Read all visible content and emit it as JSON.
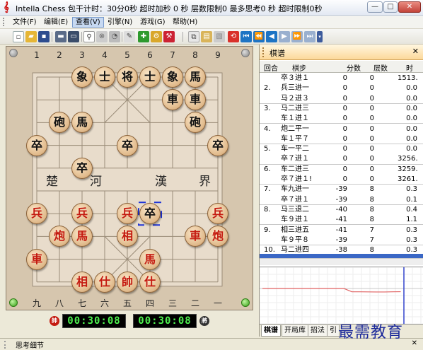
{
  "window": {
    "title": "Intella Chess 包干计时：30分0秒 超时加秒 0 秒 层数限制0 最多思考0 秒 超时限制0秒",
    "minimize": "—",
    "maximize": "□",
    "close": "✕"
  },
  "menu": [
    {
      "label": "文件(F)"
    },
    {
      "label": "编辑(E)"
    },
    {
      "label": "查看(V)"
    },
    {
      "label": "引擎(N)"
    },
    {
      "label": "游戏(G)"
    },
    {
      "label": "帮助(H)"
    }
  ],
  "board": {
    "files_top": [
      "1",
      "2",
      "3",
      "4",
      "5",
      "6",
      "7",
      "8",
      "9"
    ],
    "files_bottom": [
      "九",
      "八",
      "七",
      "六",
      "五",
      "四",
      "三",
      "二",
      "一"
    ],
    "river_left": [
      "楚",
      "河"
    ],
    "river_right": [
      "漢",
      "界"
    ],
    "pieces": [
      {
        "c": "black",
        "ch": "象",
        "f": 3,
        "r": 1
      },
      {
        "c": "black",
        "ch": "士",
        "f": 4,
        "r": 1
      },
      {
        "c": "black",
        "ch": "将",
        "f": 5,
        "r": 1
      },
      {
        "c": "black",
        "ch": "士",
        "f": 6,
        "r": 1
      },
      {
        "c": "black",
        "ch": "象",
        "f": 7,
        "r": 1
      },
      {
        "c": "black",
        "ch": "馬",
        "f": 8,
        "r": 1
      },
      {
        "c": "black",
        "ch": "車",
        "f": 7,
        "r": 2
      },
      {
        "c": "black",
        "ch": "車",
        "f": 8,
        "r": 2
      },
      {
        "c": "black",
        "ch": "砲",
        "f": 2,
        "r": 3
      },
      {
        "c": "black",
        "ch": "馬",
        "f": 3,
        "r": 3
      },
      {
        "c": "black",
        "ch": "砲",
        "f": 8,
        "r": 3
      },
      {
        "c": "black",
        "ch": "卒",
        "f": 1,
        "r": 4
      },
      {
        "c": "black",
        "ch": "卒",
        "f": 5,
        "r": 4
      },
      {
        "c": "black",
        "ch": "卒",
        "f": 9,
        "r": 4
      },
      {
        "c": "black",
        "ch": "卒",
        "f": 3,
        "r": 5
      },
      {
        "c": "red",
        "ch": "兵",
        "f": 1,
        "r": 7
      },
      {
        "c": "red",
        "ch": "兵",
        "f": 3,
        "r": 7
      },
      {
        "c": "red",
        "ch": "兵",
        "f": 5,
        "r": 7
      },
      {
        "c": "black",
        "ch": "卒",
        "f": 6,
        "r": 7
      },
      {
        "c": "red",
        "ch": "兵",
        "f": 9,
        "r": 7
      },
      {
        "c": "red",
        "ch": "炮",
        "f": 2,
        "r": 8
      },
      {
        "c": "red",
        "ch": "馬",
        "f": 3,
        "r": 8
      },
      {
        "c": "red",
        "ch": "相",
        "f": 5,
        "r": 8
      },
      {
        "c": "red",
        "ch": "車",
        "f": 8,
        "r": 8
      },
      {
        "c": "red",
        "ch": "炮",
        "f": 9,
        "r": 8
      },
      {
        "c": "red",
        "ch": "車",
        "f": 1,
        "r": 9
      },
      {
        "c": "red",
        "ch": "馬",
        "f": 6,
        "r": 9
      },
      {
        "c": "red",
        "ch": "相",
        "f": 3,
        "r": 10
      },
      {
        "c": "red",
        "ch": "仕",
        "f": 4,
        "r": 10
      },
      {
        "c": "red",
        "ch": "帥",
        "f": 5,
        "r": 10
      },
      {
        "c": "red",
        "ch": "仕",
        "f": 6,
        "r": 10
      }
    ]
  },
  "clock": {
    "red_time": "00:30:08",
    "black_time": "00:30:08",
    "red_icon": "帥",
    "black_icon": "將"
  },
  "panel": {
    "title": "棋谱",
    "close": "✕",
    "headers": [
      "回合",
      "棋步",
      "分数",
      "层数",
      "时"
    ],
    "rows": [
      {
        "round": "",
        "move": "卒３进１",
        "score": "0",
        "depth": "0",
        "time": "1513."
      },
      {
        "round": "2.",
        "move": "兵三进一",
        "score": "0",
        "depth": "0",
        "time": "0.0"
      },
      {
        "round": "",
        "move": "马２进３",
        "score": "0",
        "depth": "0",
        "time": "0.0"
      },
      {
        "round": "3.",
        "move": "马二进三",
        "score": "0",
        "depth": "0",
        "time": "0.0"
      },
      {
        "round": "",
        "move": "车１进１",
        "score": "0",
        "depth": "0",
        "time": "0.0"
      },
      {
        "round": "4.",
        "move": "炮二平一",
        "score": "0",
        "depth": "0",
        "time": "0.0"
      },
      {
        "round": "",
        "move": "车１平７",
        "score": "0",
        "depth": "0",
        "time": "0.0"
      },
      {
        "round": "5.",
        "move": "车一平二",
        "score": "0",
        "depth": "0",
        "time": "0.0"
      },
      {
        "round": "",
        "move": "卒７进１",
        "score": "0",
        "depth": "0",
        "time": "3256."
      },
      {
        "round": "6.",
        "move": "车二进三",
        "score": "0",
        "depth": "0",
        "time": "3259."
      },
      {
        "round": "",
        "move": "卒７进１!",
        "score": "0",
        "depth": "0",
        "time": "3261."
      },
      {
        "round": "7.",
        "move": "车九进一",
        "score": "-39",
        "depth": "8",
        "time": "0.3"
      },
      {
        "round": "",
        "move": "卒７进１",
        "score": "-39",
        "depth": "8",
        "time": "0.1"
      },
      {
        "round": "8.",
        "move": "马三退二",
        "score": "-40",
        "depth": "8",
        "time": "0.4"
      },
      {
        "round": "",
        "move": "车９进１",
        "score": "-41",
        "depth": "8",
        "time": "1.1"
      },
      {
        "round": "9.",
        "move": "相三进五",
        "score": "-41",
        "depth": "7",
        "time": "0.3"
      },
      {
        "round": "",
        "move": "车９平８",
        "score": "-39",
        "depth": "7",
        "time": "0.3"
      },
      {
        "round": "10.",
        "move": "马二进四",
        "score": "-38",
        "depth": "8",
        "time": "0.3"
      }
    ],
    "tabs": [
      "棋谱",
      "开局库",
      "招法",
      "引"
    ]
  },
  "statusbar": {
    "label": "思考细节",
    "close": "✕"
  },
  "watermark": "最需教育",
  "colors": {
    "red_piece": "#c41a10",
    "black_piece": "#111111",
    "clock_digits": "#4ef04e",
    "selection": "#1f33d6",
    "panel_highlight": "#3a67c5",
    "eval_line": "#e06060"
  }
}
